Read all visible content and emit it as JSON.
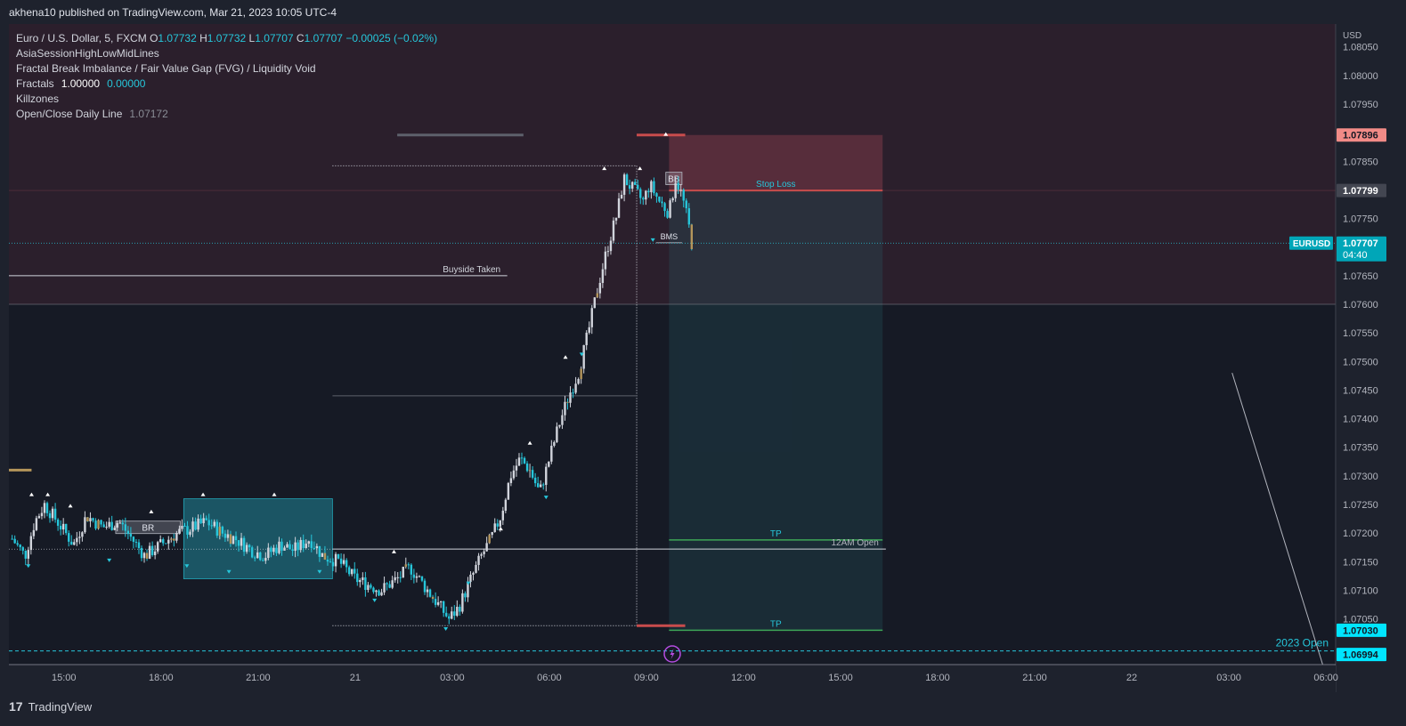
{
  "header": {
    "published": "akhena10 published on TradingView.com, Mar 21, 2023 10:05 UTC-4"
  },
  "legend": {
    "symbol": "Euro / U.S. Dollar, 5, FXCM",
    "ohlc": [
      {
        "k": "O",
        "v": "1.07732"
      },
      {
        "k": "H",
        "v": "1.07732"
      },
      {
        "k": "L",
        "v": "1.07707"
      },
      {
        "k": "C",
        "v": "1.07707"
      }
    ],
    "change": "−0.00025 (−0.02%)",
    "indicators": [
      {
        "name": "AsiaSessionHighLowMidLines",
        "values": []
      },
      {
        "name": "Fractal Break Imbalance / Fair Value Gap (FVG) / Liquidity Void",
        "values": []
      },
      {
        "name": "Fractals",
        "values": [
          "1.00000",
          "0.00000"
        ]
      },
      {
        "name": "Killzones",
        "values": []
      },
      {
        "name": "Open/Close Daily Line",
        "values": [
          "1.07172"
        ]
      }
    ]
  },
  "colors": {
    "background": "#161a25",
    "up": "#d1d4dc",
    "down": "#26c6da",
    "accent": "#b4955a",
    "stop_zone": "#5b2e3a",
    "target_zone": "#1f3b40",
    "stop_line": "#c84c4c",
    "tp_line": "#3da557",
    "price_badge": "#00bcd4"
  },
  "chart_data": {
    "type": "candlestick",
    "symbol": "EURUSD",
    "timeframe": "5",
    "currency_label": "USD",
    "x_tick_labels": [
      "15:00",
      "18:00",
      "21:00",
      "21",
      "03:00",
      "06:00",
      "09:00",
      "12:00",
      "15:00",
      "18:00",
      "21:00",
      "22",
      "03:00",
      "06:00"
    ],
    "x_tick_hours": [
      15,
      18,
      21,
      24,
      27,
      30,
      33,
      36,
      39,
      42,
      45,
      48,
      51,
      54
    ],
    "x_range_hours": [
      13.3,
      54.3
    ],
    "y_range": [
      1.0697,
      1.0809
    ],
    "y_ticks": [
      "1.08050",
      "1.08000",
      "1.07950",
      "1.07850",
      "1.07750",
      "1.07650",
      "1.07600",
      "1.07550",
      "1.07500",
      "1.07450",
      "1.07400",
      "1.07350",
      "1.07300",
      "1.07250",
      "1.07200",
      "1.07150",
      "1.07100",
      "1.07050"
    ],
    "price_badges": [
      {
        "value": "1.07896",
        "kind": "stop"
      },
      {
        "value": "1.07799",
        "kind": "entry"
      },
      {
        "value": "1.07707",
        "kind": "last",
        "label": "EURUSD",
        "countdown": "04:40"
      },
      {
        "value": "1.07030",
        "kind": "tp"
      },
      {
        "value": "1.06994",
        "kind": "yearopen"
      }
    ],
    "close_path": [
      [
        13.4,
        1.0719
      ],
      [
        13.8,
        1.0716
      ],
      [
        14.1,
        1.0722
      ],
      [
        14.4,
        1.0725
      ],
      [
        14.8,
        1.0722
      ],
      [
        15.3,
        1.0718
      ],
      [
        15.7,
        1.0723
      ],
      [
        16.2,
        1.0721
      ],
      [
        16.7,
        1.0722
      ],
      [
        17.1,
        1.0719
      ],
      [
        17.5,
        1.0716
      ],
      [
        18.0,
        1.0718
      ],
      [
        18.5,
        1.072
      ],
      [
        19.0,
        1.0721
      ],
      [
        19.4,
        1.0722
      ],
      [
        19.9,
        1.072
      ],
      [
        20.3,
        1.0719
      ],
      [
        20.8,
        1.0717
      ],
      [
        21.2,
        1.0716
      ],
      [
        21.7,
        1.0718
      ],
      [
        22.1,
        1.0717
      ],
      [
        22.6,
        1.0719
      ],
      [
        23.0,
        1.0716
      ],
      [
        23.5,
        1.0715
      ],
      [
        24.0,
        1.0712
      ],
      [
        24.4,
        1.0711
      ],
      [
        24.8,
        1.071
      ],
      [
        25.3,
        1.0712
      ],
      [
        25.7,
        1.0714
      ],
      [
        26.1,
        1.0711
      ],
      [
        26.5,
        1.0708
      ],
      [
        26.9,
        1.0705
      ],
      [
        27.2,
        1.0707
      ],
      [
        27.5,
        1.0711
      ],
      [
        27.9,
        1.0716
      ],
      [
        28.2,
        1.0719
      ],
      [
        28.5,
        1.0723
      ],
      [
        28.8,
        1.073
      ],
      [
        29.1,
        1.0733
      ],
      [
        29.4,
        1.0731
      ],
      [
        29.7,
        1.0727
      ],
      [
        30.0,
        1.0733
      ],
      [
        30.3,
        1.0739
      ],
      [
        30.6,
        1.0744
      ],
      [
        30.9,
        1.0748
      ],
      [
        31.2,
        1.0755
      ],
      [
        31.5,
        1.0763
      ],
      [
        31.8,
        1.077
      ],
      [
        32.1,
        1.0776
      ],
      [
        32.3,
        1.0782
      ],
      [
        32.6,
        1.078
      ],
      [
        32.9,
        1.0778
      ],
      [
        33.1,
        1.0781
      ],
      [
        33.4,
        1.0778
      ],
      [
        33.7,
        1.0776
      ],
      [
        33.9,
        1.0782
      ],
      [
        34.1,
        1.0779
      ],
      [
        34.3,
        1.0774
      ],
      [
        34.4,
        1.07707
      ]
    ],
    "fractal_markers_high": [
      [
        14.0,
        1.0726
      ],
      [
        14.5,
        1.0726
      ],
      [
        15.2,
        1.0724
      ],
      [
        17.7,
        1.0723
      ],
      [
        19.3,
        1.0726
      ],
      [
        21.5,
        1.0726
      ],
      [
        25.2,
        1.0716
      ],
      [
        28.5,
        1.072
      ],
      [
        29.4,
        1.0735
      ],
      [
        30.5,
        1.075
      ],
      [
        31.7,
        1.0783
      ],
      [
        32.8,
        1.0783
      ],
      [
        33.6,
        1.0789
      ]
    ],
    "fractal_markers_low": [
      [
        13.9,
        1.0715
      ],
      [
        16.4,
        1.0716
      ],
      [
        18.8,
        1.0715
      ],
      [
        20.1,
        1.0714
      ],
      [
        22.9,
        1.0714
      ],
      [
        24.6,
        1.0709
      ],
      [
        26.8,
        1.0704
      ],
      [
        27.5,
        1.0712
      ],
      [
        29.9,
        1.0727
      ],
      [
        31.0,
        1.0752
      ],
      [
        33.2,
        1.0772
      ]
    ],
    "annotations": [
      {
        "text": "Buyside Taken",
        "price": 1.0765,
        "x_from": 13.3,
        "x_to": 28.7
      },
      {
        "text": "Stop Loss",
        "price": 1.07799,
        "x_from": 33.7,
        "x_to": 40.3
      },
      {
        "text": "TP",
        "price": 1.07188,
        "x_from": 33.7,
        "x_to": 40.3
      },
      {
        "text": "TP",
        "price": 1.0703,
        "x_from": 33.7,
        "x_to": 40.3
      },
      {
        "text": "12AM Open",
        "price": 1.07172,
        "x_from": 23.3,
        "x_to": 40.4
      },
      {
        "text": "2023 Open",
        "price": 1.06994,
        "x_from": 13.3,
        "x_to": 54.3
      },
      {
        "text": "BR",
        "price": 1.0721,
        "x_from": 16.6,
        "x_to": 18.6
      },
      {
        "text": "BB",
        "price": 1.0782,
        "x_from": 33.6,
        "x_to": 34.1
      },
      {
        "text": "BMS",
        "price": 1.0772,
        "x_from": 33.3,
        "x_to": 34.1
      }
    ],
    "zones": [
      {
        "kind": "killzone",
        "price_from": 1.076,
        "price_to": 1.0809,
        "x_from": 13.3,
        "x_to": 54.3
      },
      {
        "kind": "stop",
        "price_from": 1.07799,
        "price_to": 1.07896,
        "x_from": 33.7,
        "x_to": 40.3
      },
      {
        "kind": "target",
        "price_from": 1.0703,
        "price_to": 1.07799,
        "x_from": 33.7,
        "x_to": 40.3
      },
      {
        "kind": "asia",
        "price_from": 1.0712,
        "price_to": 1.0726,
        "x_from": 18.7,
        "x_to": 23.3
      }
    ],
    "grid": false
  },
  "footer": {
    "brand": "TradingView"
  }
}
